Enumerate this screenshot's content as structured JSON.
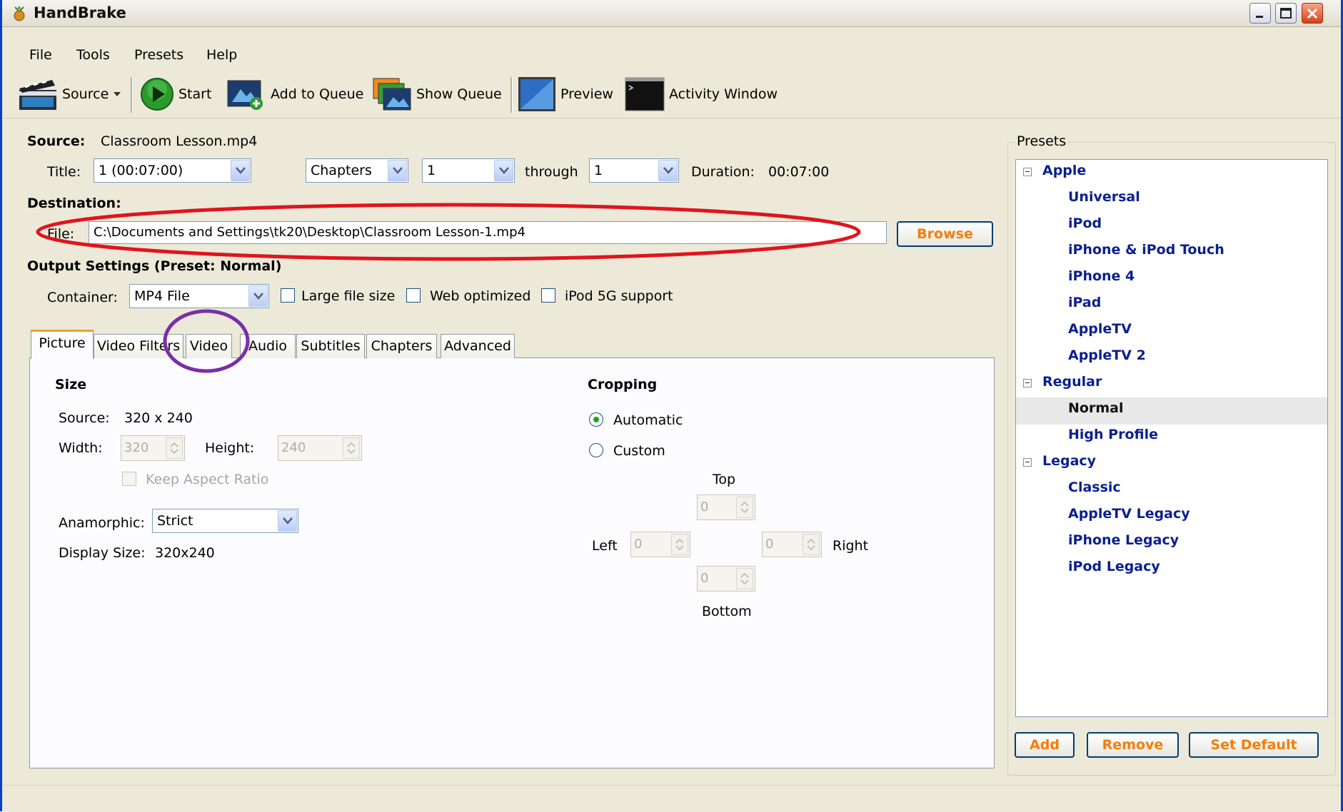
{
  "window": {
    "title": "HandBrake"
  },
  "menu": [
    "File",
    "Tools",
    "Presets",
    "Help"
  ],
  "toolbar": {
    "source": "Source",
    "start": "Start",
    "add_queue": "Add to Queue",
    "show_queue": "Show Queue",
    "preview": "Preview",
    "activity": "Activity Window"
  },
  "source": {
    "label": "Source:",
    "file": "Classroom Lesson.mp4"
  },
  "title_row": {
    "title_label": "Title:",
    "title_value": "1 (00:07:00)",
    "range_mode": "Chapters",
    "from": "1",
    "through_label": "through",
    "to": "1",
    "duration_label": "Duration:",
    "duration_value": "00:07:00"
  },
  "destination": {
    "label": "Destination:",
    "file_label": "File:",
    "file_value": "C:\\Documents and Settings\\tk20\\Desktop\\Classroom Lesson-1.mp4",
    "browse": "Browse"
  },
  "output": {
    "label": "Output Settings (Preset: Normal)",
    "container_label": "Container:",
    "container_value": "MP4 File",
    "large_file": "Large file size",
    "web_optimized": "Web optimized",
    "ipod5g": "iPod 5G support"
  },
  "tabs": [
    "Picture",
    "Video Filters",
    "Video",
    "Audio",
    "Subtitles",
    "Chapters",
    "Advanced"
  ],
  "picture": {
    "size_heading": "Size",
    "source_label": "Source:",
    "source_value": "320 x 240",
    "width_label": "Width:",
    "width_value": "320",
    "height_label": "Height:",
    "height_value": "240",
    "keep_aspect": "Keep Aspect Ratio",
    "anamorphic_label": "Anamorphic:",
    "anamorphic_value": "Strict",
    "display_label": "Display Size:",
    "display_value": "320x240",
    "cropping_heading": "Cropping",
    "automatic": "Automatic",
    "custom": "Custom",
    "top": "Top",
    "left": "Left",
    "right": "Right",
    "bottom": "Bottom",
    "crop_top": "0",
    "crop_left": "0",
    "crop_right": "0",
    "crop_bottom": "0"
  },
  "presets": {
    "group_label": "Presets",
    "groups": [
      {
        "name": "Apple",
        "items": [
          "Universal",
          "iPod",
          "iPhone & iPod Touch",
          "iPhone 4",
          "iPad",
          "AppleTV",
          "AppleTV 2"
        ]
      },
      {
        "name": "Regular",
        "items": [
          "Normal",
          "High Profile"
        ]
      },
      {
        "name": "Legacy",
        "items": [
          "Classic",
          "AppleTV Legacy",
          "iPhone Legacy",
          "iPod Legacy"
        ]
      }
    ],
    "selected": "Normal",
    "add": "Add",
    "remove": "Remove",
    "set_default": "Set Default"
  },
  "colors": {
    "preset_text": "#0a1f8f",
    "button_text": "#f37e0b",
    "annotation_red": "#e0141e",
    "annotation_purple": "#7a2ea8"
  }
}
